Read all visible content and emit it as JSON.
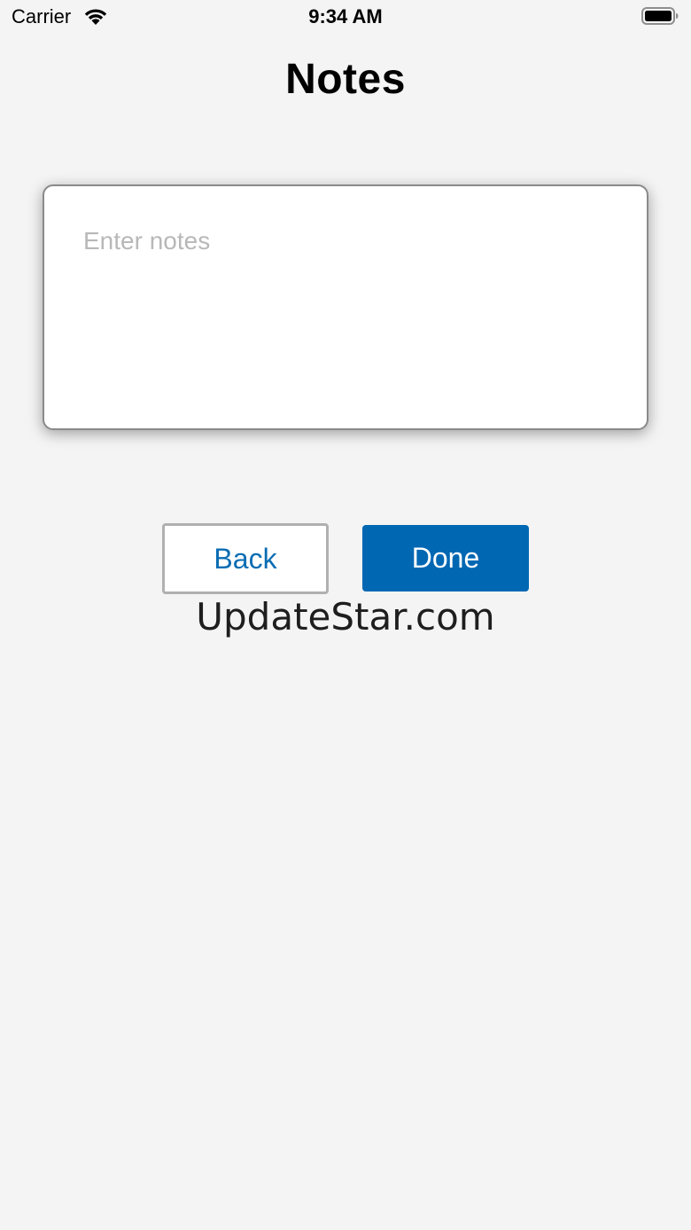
{
  "status_bar": {
    "carrier": "Carrier",
    "time": "9:34 AM",
    "wifi_icon": "wifi-icon",
    "battery_icon": "battery-icon"
  },
  "header": {
    "title": "Notes"
  },
  "notes": {
    "value": "",
    "placeholder": "Enter notes"
  },
  "actions": {
    "back_label": "Back",
    "done_label": "Done"
  },
  "watermark": {
    "text": "UpdateStar.com"
  },
  "colors": {
    "accent": "#0067b3",
    "back_text": "#0a6db3",
    "background": "#f4f4f4"
  }
}
